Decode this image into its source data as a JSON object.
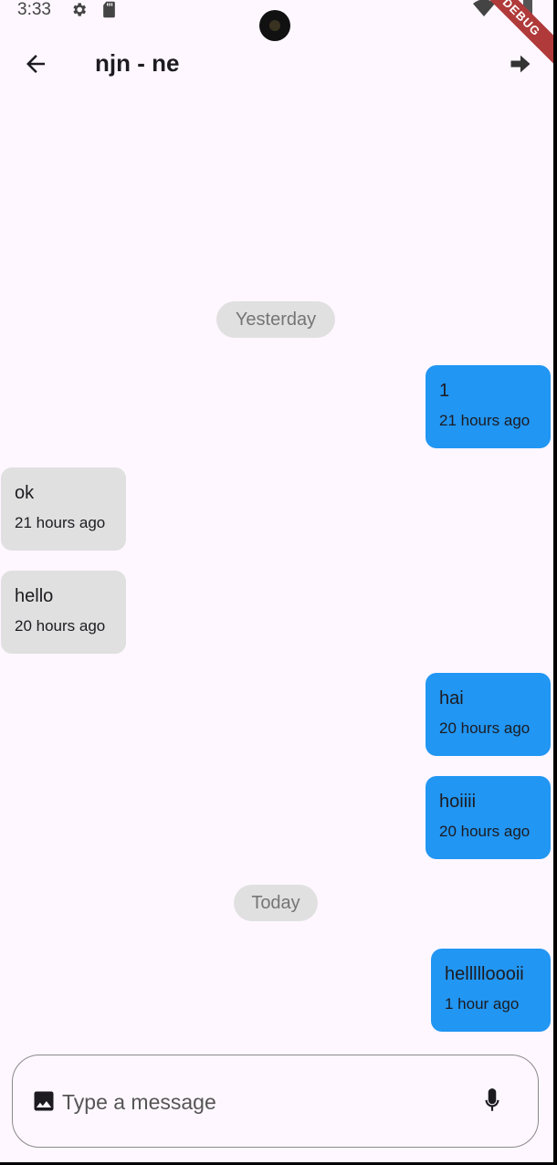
{
  "status_bar": {
    "time": "3:33",
    "icons": [
      "gear-icon",
      "sd-card-icon",
      "wifi-icon",
      "battery-icon"
    ]
  },
  "debug_banner": "DEBUG",
  "app_bar": {
    "title": "njn - ne",
    "back_icon": "arrow-back-icon",
    "forward_icon": "arrow-forward-icon"
  },
  "chat": {
    "date_chips": [
      "Yesterday",
      "Today"
    ],
    "messages": [
      {
        "text": "1",
        "time": "21 hours ago",
        "direction": "sent"
      },
      {
        "text": "ok",
        "time": "21 hours ago",
        "direction": "received"
      },
      {
        "text": "hello",
        "time": "20 hours ago",
        "direction": "received"
      },
      {
        "text": "hai",
        "time": "20 hours ago",
        "direction": "sent"
      },
      {
        "text": "hoiiii",
        "time": "20 hours ago",
        "direction": "sent"
      },
      {
        "text": "hellllloooii",
        "time": "1 hour ago",
        "direction": "sent"
      }
    ]
  },
  "composer": {
    "placeholder": "Type a message",
    "value": "",
    "image_icon": "image-icon",
    "mic_icon": "mic-icon"
  },
  "colors": {
    "background": "#fef7ff",
    "sent_bubble": "#2196f3",
    "received_bubble": "#e0e0e0",
    "date_chip": "#e0e0e0",
    "debug_banner": "#b03a3a"
  }
}
